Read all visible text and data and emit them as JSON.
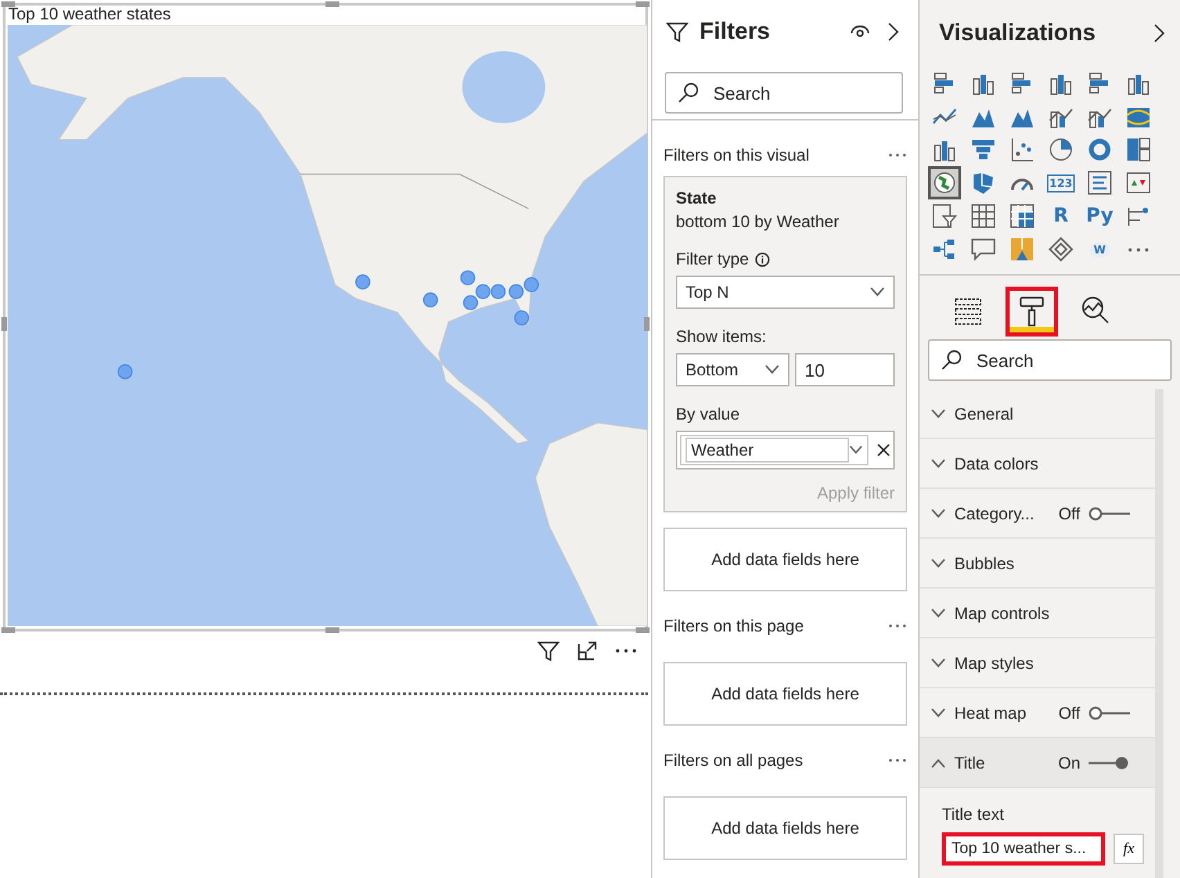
{
  "visual": {
    "title": "Top 10 weather states"
  },
  "filters": {
    "title": "Filters",
    "search": {
      "placeholder": "Search"
    },
    "sections": [
      {
        "title": "Filters on this visual",
        "card": {
          "field": "State",
          "summary": "bottom 10 by Weather",
          "filter_type_label": "Filter type",
          "filter_type": "Top N",
          "show_items_label": "Show items:",
          "show_direction": "Bottom",
          "show_count": "10",
          "by_value_label": "By value",
          "by_value": "Weather",
          "apply": {
            "label": "Apply filter",
            "disabled": true
          }
        },
        "dropzone": "Add data fields here"
      },
      {
        "title": "Filters on this page",
        "dropzone": "Add data fields here"
      },
      {
        "title": "Filters on all pages",
        "dropzone": "Add data fields here"
      }
    ]
  },
  "visualizations": {
    "title": "Visualizations",
    "items": [
      {
        "kind": "hbar",
        "selected": false
      },
      {
        "kind": "vbar",
        "selected": false
      },
      {
        "kind": "hbar",
        "selected": false
      },
      {
        "kind": "vbar",
        "selected": false
      },
      {
        "kind": "hbar",
        "selected": false
      },
      {
        "kind": "vbar",
        "selected": false
      },
      {
        "kind": "line",
        "selected": false
      },
      {
        "kind": "area",
        "selected": false
      },
      {
        "kind": "area",
        "selected": false
      },
      {
        "kind": "combo",
        "selected": false
      },
      {
        "kind": "combo",
        "selected": false
      },
      {
        "kind": "ribbon",
        "selected": false
      },
      {
        "kind": "vbar",
        "selected": false
      },
      {
        "kind": "funnel",
        "selected": false
      },
      {
        "kind": "scatter",
        "selected": false
      },
      {
        "kind": "pie",
        "selected": false
      },
      {
        "kind": "donut",
        "selected": false
      },
      {
        "kind": "treemap",
        "selected": false
      },
      {
        "kind": "globe",
        "selected": true
      },
      {
        "kind": "filledmap",
        "selected": false
      },
      {
        "kind": "gauge",
        "selected": false
      },
      {
        "kind": "card",
        "label": "123",
        "selected": false
      },
      {
        "kind": "list",
        "selected": false
      },
      {
        "kind": "kpi",
        "selected": false
      },
      {
        "kind": "slicer",
        "selected": false
      },
      {
        "kind": "table",
        "selected": false
      },
      {
        "kind": "matrix",
        "selected": false
      },
      {
        "kind": "text",
        "label": "R",
        "selected": false
      },
      {
        "kind": "text",
        "label": "Py",
        "selected": false
      },
      {
        "kind": "influencers",
        "selected": false
      },
      {
        "kind": "tree",
        "selected": false
      },
      {
        "kind": "bubble",
        "selected": false
      },
      {
        "kind": "shapemap",
        "selected": false
      },
      {
        "kind": "diamond",
        "selected": false
      },
      {
        "kind": "cloud",
        "label": "W",
        "selected": false
      },
      {
        "kind": "more",
        "selected": false
      }
    ],
    "tabs": [
      {
        "kind": "fields",
        "selected": false,
        "highlighted": false
      },
      {
        "kind": "format",
        "selected": true,
        "highlighted": true
      },
      {
        "kind": "analytics",
        "selected": false,
        "highlighted": false
      }
    ],
    "search": {
      "placeholder": "Search"
    },
    "sections": [
      {
        "title": "General",
        "expanded": false
      },
      {
        "title": "Data colors",
        "expanded": false
      },
      {
        "title": "Category...",
        "expanded": false,
        "toggle": {
          "label": "Off",
          "on": false
        }
      },
      {
        "title": "Bubbles",
        "expanded": false
      },
      {
        "title": "Map controls",
        "expanded": false
      },
      {
        "title": "Map styles",
        "expanded": false
      },
      {
        "title": "Heat map",
        "expanded": false,
        "toggle": {
          "label": "Off",
          "on": false
        }
      },
      {
        "title": "Title",
        "expanded": true,
        "toggle": {
          "label": "On",
          "on": true
        },
        "field": {
          "label": "Title text",
          "value": "Top 10 weather s...",
          "highlighted": true,
          "fx": "fx"
        }
      }
    ]
  }
}
